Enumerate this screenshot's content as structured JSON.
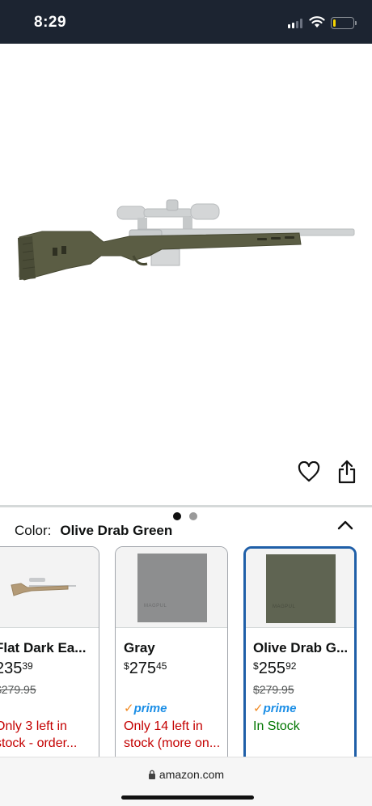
{
  "status_bar": {
    "time": "8:29",
    "battery_level": 0.12
  },
  "product": {
    "image_pages": 2,
    "active_page": 1
  },
  "selection": {
    "color_label": "Color:",
    "color_value": "Olive Drab Green"
  },
  "variants": [
    {
      "name": "Flat Dark Ea...",
      "price_currency": "",
      "price_whole": "235",
      "price_fraction": "39",
      "list_price": "$279.95",
      "prime": "",
      "stock": "Only 3 left in stock - order...",
      "stock_color": "#c40000",
      "swatch_color": "#f3f3f3"
    },
    {
      "name": "Gray",
      "price_currency": "$",
      "price_whole": "275",
      "price_fraction": "45",
      "list_price": "",
      "prime": "prime",
      "stock": "Only 14 left in stock (more on...",
      "stock_color": "#c40000",
      "swatch_color": "#8d8e8f"
    },
    {
      "name": "Olive Drab G...",
      "price_currency": "$",
      "price_whole": "255",
      "price_fraction": "92",
      "list_price": "$279.95",
      "prime": "prime",
      "stock": "In Stock",
      "stock_color": "#007600",
      "swatch_color": "#5f6452"
    }
  ],
  "browser": {
    "url": "amazon.com"
  },
  "colors": {
    "status_bar_bg": "#1c2431",
    "selected_border": "#1f5fa8",
    "stock_red": "#c40000",
    "stock_green": "#007600",
    "prime_blue": "#1b8ee6",
    "stock_olive": "#4f513d"
  }
}
